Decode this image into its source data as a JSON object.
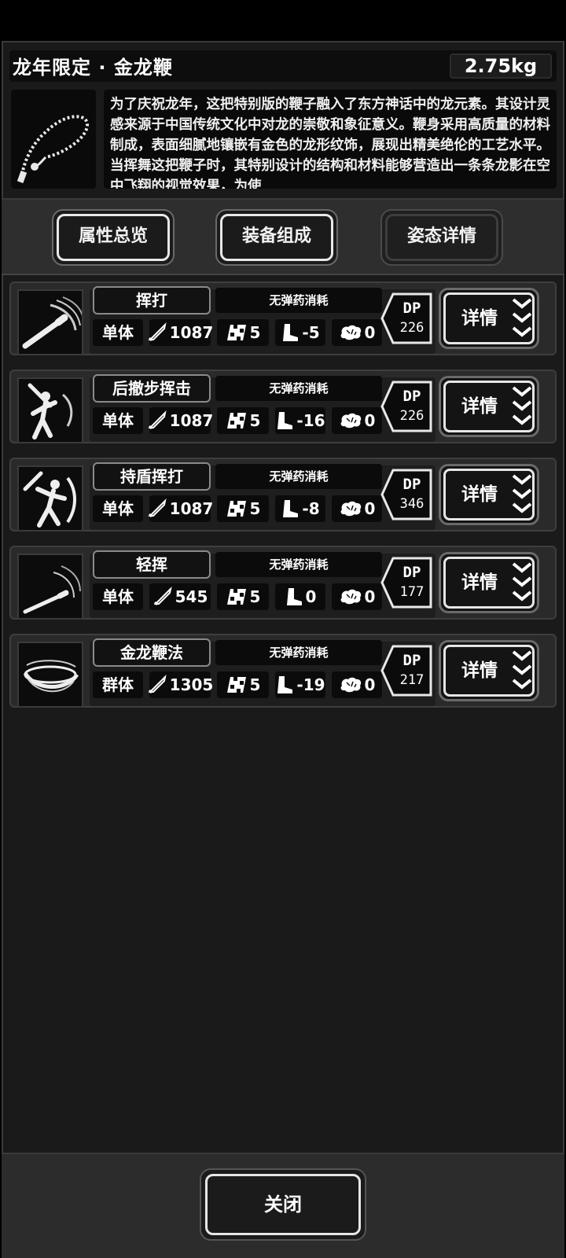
{
  "header": {
    "title": "龙年限定 · 金龙鞭",
    "weight": "2.75kg",
    "description": "为了庆祝龙年，这把特别版的鞭子融入了东方神话中的龙元素。其设计灵感来源于中国传统文化中对龙的崇敬和象征意义。鞭身采用高质量的材料制成，表面细腻地镶嵌有金色的龙形纹饰，展现出精美绝伦的工艺水平。当挥舞这把鞭子时，其特别设计的结构和材料能够营造出一条条龙影在空中飞翔的视觉效果，为使"
  },
  "tabs": [
    {
      "label": "属性总览"
    },
    {
      "label": "装备组成"
    },
    {
      "label": "姿态详情"
    }
  ],
  "skills": [
    {
      "name": "挥打",
      "ammo": "无弹药消耗",
      "target": "单体",
      "attack": "1087",
      "speed": "5",
      "move": "-5",
      "mind": "0",
      "dp_label": "DP",
      "dp": "226",
      "detail": "详情"
    },
    {
      "name": "后撤步挥击",
      "ammo": "无弹药消耗",
      "target": "单体",
      "attack": "1087",
      "speed": "5",
      "move": "-16",
      "mind": "0",
      "dp_label": "DP",
      "dp": "226",
      "detail": "详情"
    },
    {
      "name": "持盾挥打",
      "ammo": "无弹药消耗",
      "target": "单体",
      "attack": "1087",
      "speed": "5",
      "move": "-8",
      "mind": "0",
      "dp_label": "DP",
      "dp": "346",
      "detail": "详情"
    },
    {
      "name": "轻挥",
      "ammo": "无弹药消耗",
      "target": "单体",
      "attack": "545",
      "speed": "5",
      "move": "0",
      "mind": "0",
      "dp_label": "DP",
      "dp": "177",
      "detail": "详情"
    },
    {
      "name": "金龙鞭法",
      "ammo": "无弹药消耗",
      "target": "群体",
      "attack": "1305",
      "speed": "5",
      "move": "-19",
      "mind": "0",
      "dp_label": "DP",
      "dp": "217",
      "detail": "详情"
    }
  ],
  "footer": {
    "close_label": "关闭"
  }
}
